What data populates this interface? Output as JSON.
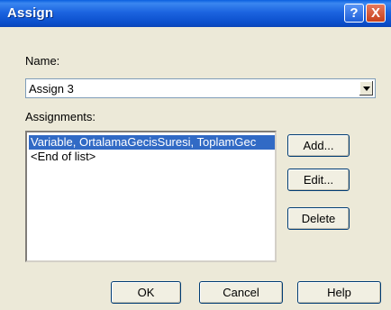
{
  "window": {
    "title": "Assign"
  },
  "title_buttons": {
    "help": "?",
    "close": "X"
  },
  "name_field": {
    "label": "Name:",
    "value": "Assign 3"
  },
  "assignments": {
    "label": "Assignments:",
    "items": [
      {
        "text": "Variable, OrtalamaGecisSuresi, ToplamGec",
        "selected": true
      },
      {
        "text": "<End of list>",
        "selected": false
      }
    ]
  },
  "side_buttons": {
    "add": "Add...",
    "edit": "Edit...",
    "delete": "Delete"
  },
  "bottom_buttons": {
    "ok": "OK",
    "cancel": "Cancel",
    "help": "Help"
  },
  "colors": {
    "titlebar": "#0a4ecb",
    "selection": "#316ac5",
    "dialog_bg": "#ece9d8"
  }
}
